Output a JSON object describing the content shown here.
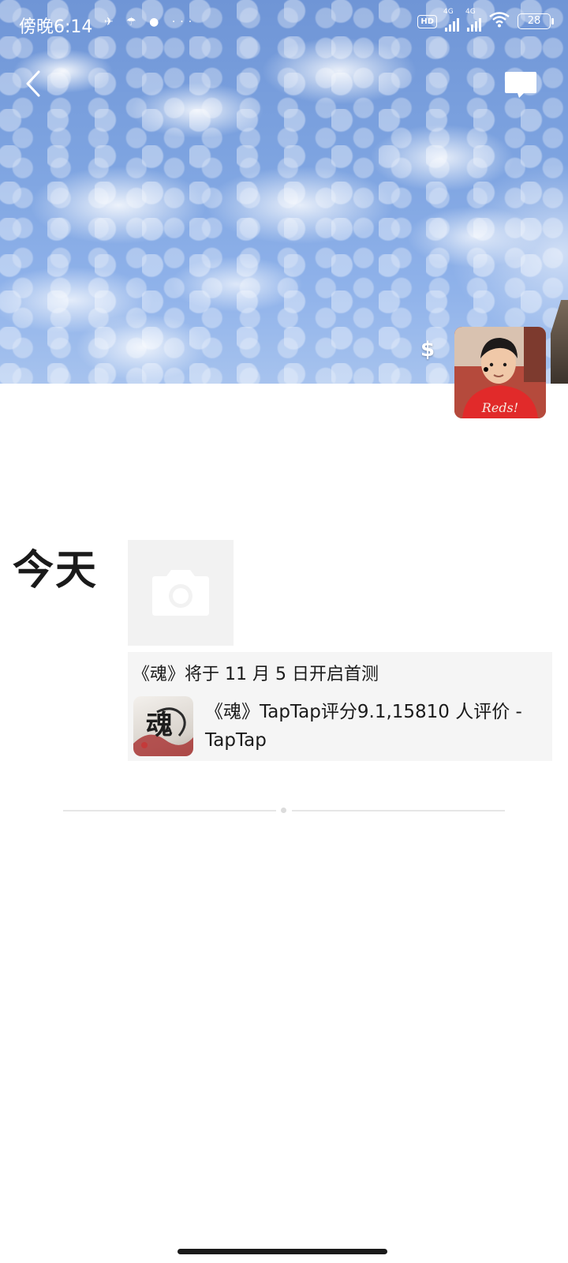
{
  "status_bar": {
    "time": "傍晚6:14",
    "left_icons": "✈ ☂ ● ···",
    "hd_label": "HD",
    "network_1": "4G",
    "network_2": "4G",
    "battery": "28"
  },
  "header": {
    "back_icon": "chevron-left-icon",
    "chat_icon": "chat-bubble-icon",
    "currency_symbol": "$"
  },
  "timeline": {
    "day_label": "今天",
    "photo_icon": "camera-icon",
    "post": {
      "title": "《魂》将于 11 月 5 日开启首测",
      "link_text": "《魂》TapTap评分9.1,15810 人评价 - TapTap",
      "thumb_glyph": "魂"
    }
  },
  "colors": {
    "sky": "#7da3e0",
    "card_bg": "#f5f5f5",
    "placeholder_bg": "#f2f2f2"
  }
}
